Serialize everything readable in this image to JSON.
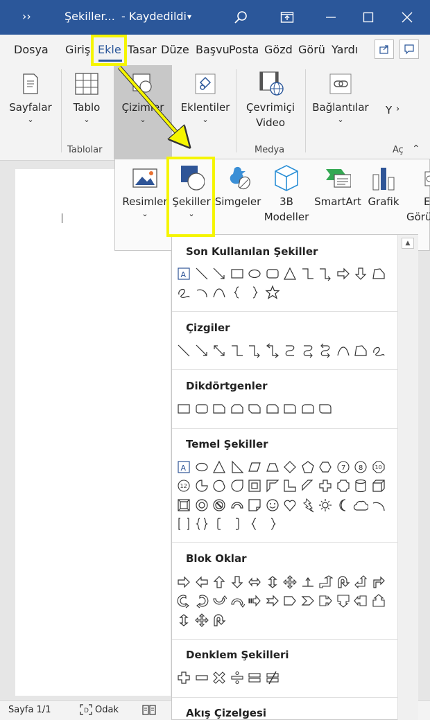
{
  "title_bar": {
    "prefix": "››",
    "doc_name": "Şekiller...",
    "save_status": "- Kaydedildi",
    "save_chevron": "▾"
  },
  "tabs": [
    "Dosya",
    "Giriş",
    "Ekle",
    "Tasar",
    "Düze",
    "Başvu",
    "Posta",
    "Gözd",
    "Görü",
    "Yardı"
  ],
  "ribbon": {
    "sayfalar": "Sayfalar",
    "tablo": "Tablo",
    "cizimler": "Çizimler",
    "eklentiler": "Eklentiler",
    "cevrimici_1": "Çevrimiçi",
    "cevrimici_2": "Video",
    "baglantilar": "Bağlantılar",
    "y_partial": "Y",
    "groups": {
      "tablolar": "Tablolar",
      "medya": "Medya",
      "ac": "Aç"
    }
  },
  "drawing_menu": {
    "resimler": "Resimler",
    "sekiller": "Şekiller",
    "simgeler": "Simgeler",
    "modeller_1": "3B",
    "modeller_2": "Modeller",
    "smartart": "SmartArt",
    "grafik": "Grafik",
    "e_partial": "E",
    "goru_partial": "Görü"
  },
  "gallery": {
    "son": "Son Kullanılan Şekiller",
    "cizgiler": "Çizgiler",
    "dikdortgenler": "Dikdörtgenler",
    "temel": "Temel Şekiller",
    "blok": "Blok Oklar",
    "denklem": "Denklem Şekilleri",
    "akis": "Akış Çizelgesi"
  },
  "status_bar": {
    "page": "Sayfa 1/1",
    "focus": "Odak"
  },
  "colors": {
    "brand": "#2b579a",
    "highlight": "#f5f500",
    "shape_icon": "#2f5597"
  }
}
